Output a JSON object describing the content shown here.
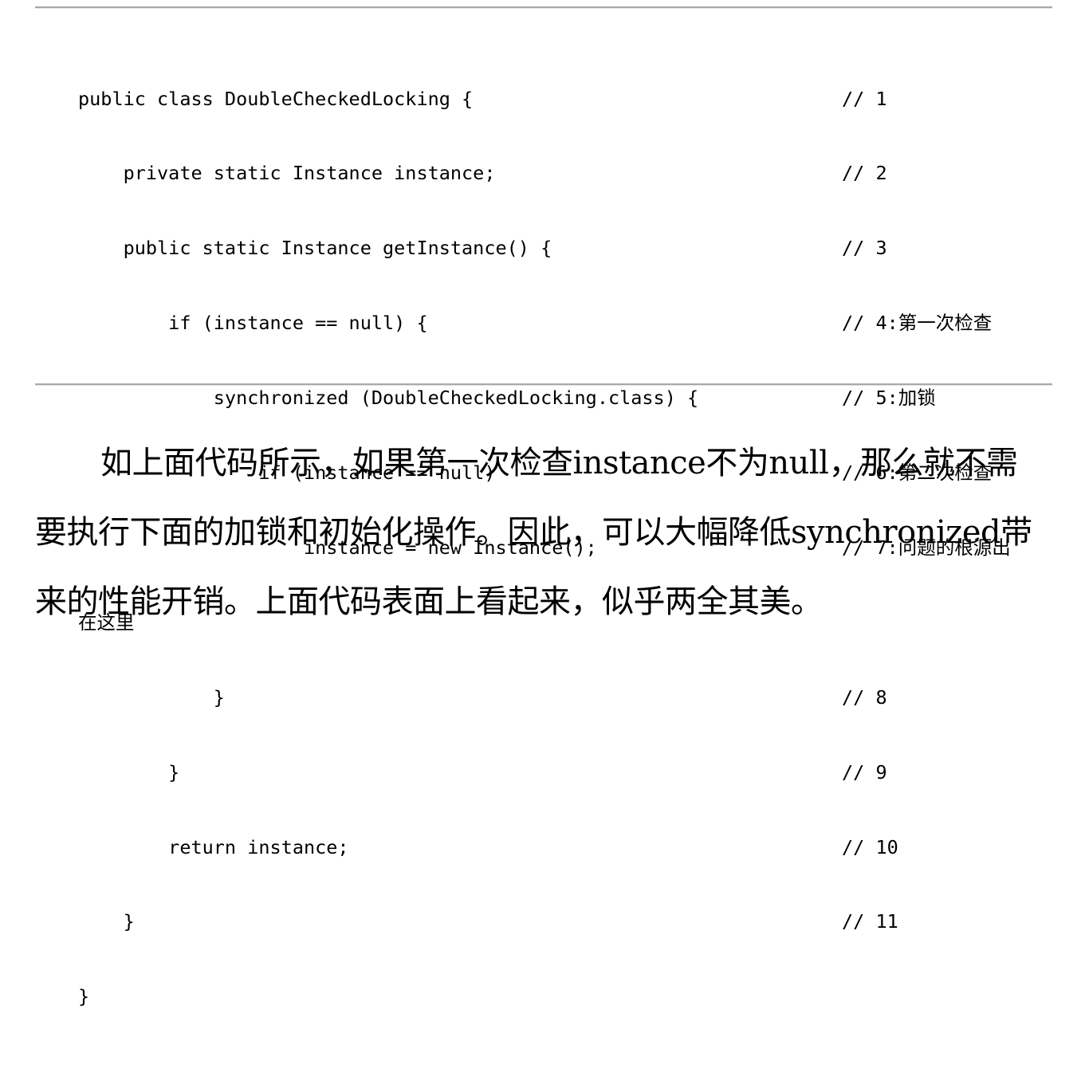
{
  "code": {
    "lines": [
      {
        "text": "public class DoubleCheckedLocking {",
        "comment": "// 1"
      },
      {
        "text": "    private static Instance instance;",
        "comment": "// 2"
      },
      {
        "text": "    public static Instance getInstance() {",
        "comment": "// 3"
      },
      {
        "text": "        if (instance == null) {",
        "comment": "// 4:第一次检查"
      },
      {
        "text": "            synchronized (DoubleCheckedLocking.class) {",
        "comment": "// 5:加锁"
      },
      {
        "text": "                if (instance == null)",
        "comment": "// 6:第二次检查"
      },
      {
        "text": "                    instance = new Instance();",
        "comment": "// 7:问题的根源出"
      },
      {
        "text": "在这里",
        "comment": ""
      },
      {
        "text": "            }",
        "comment": "// 8"
      },
      {
        "text": "        }",
        "comment": "// 9"
      },
      {
        "text": "        return instance;",
        "comment": "// 10"
      },
      {
        "text": "    }",
        "comment": "// 11"
      },
      {
        "text": "}",
        "comment": ""
      }
    ]
  },
  "paragraph": {
    "text": "如上面代码所示，如果第一次检查instance不为null，那么就不需要执行下面的加锁和初始化操作。因此，可以大幅降低synchronized带来的性能开销。上面代码表面上看起来，似乎两全其美。"
  }
}
